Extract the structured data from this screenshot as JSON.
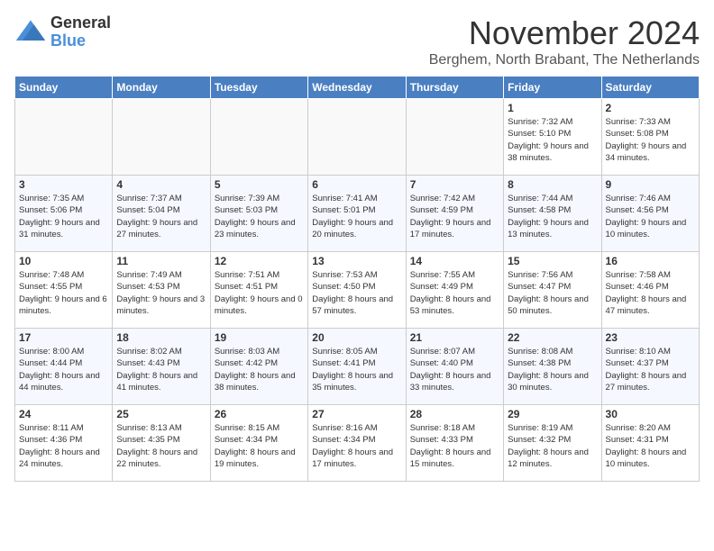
{
  "header": {
    "logo_general": "General",
    "logo_blue": "Blue",
    "title": "November 2024",
    "subtitle": "Berghem, North Brabant, The Netherlands"
  },
  "weekdays": [
    "Sunday",
    "Monday",
    "Tuesday",
    "Wednesday",
    "Thursday",
    "Friday",
    "Saturday"
  ],
  "weeks": [
    [
      {
        "day": "",
        "info": ""
      },
      {
        "day": "",
        "info": ""
      },
      {
        "day": "",
        "info": ""
      },
      {
        "day": "",
        "info": ""
      },
      {
        "day": "",
        "info": ""
      },
      {
        "day": "1",
        "info": "Sunrise: 7:32 AM\nSunset: 5:10 PM\nDaylight: 9 hours and 38 minutes."
      },
      {
        "day": "2",
        "info": "Sunrise: 7:33 AM\nSunset: 5:08 PM\nDaylight: 9 hours and 34 minutes."
      }
    ],
    [
      {
        "day": "3",
        "info": "Sunrise: 7:35 AM\nSunset: 5:06 PM\nDaylight: 9 hours and 31 minutes."
      },
      {
        "day": "4",
        "info": "Sunrise: 7:37 AM\nSunset: 5:04 PM\nDaylight: 9 hours and 27 minutes."
      },
      {
        "day": "5",
        "info": "Sunrise: 7:39 AM\nSunset: 5:03 PM\nDaylight: 9 hours and 23 minutes."
      },
      {
        "day": "6",
        "info": "Sunrise: 7:41 AM\nSunset: 5:01 PM\nDaylight: 9 hours and 20 minutes."
      },
      {
        "day": "7",
        "info": "Sunrise: 7:42 AM\nSunset: 4:59 PM\nDaylight: 9 hours and 17 minutes."
      },
      {
        "day": "8",
        "info": "Sunrise: 7:44 AM\nSunset: 4:58 PM\nDaylight: 9 hours and 13 minutes."
      },
      {
        "day": "9",
        "info": "Sunrise: 7:46 AM\nSunset: 4:56 PM\nDaylight: 9 hours and 10 minutes."
      }
    ],
    [
      {
        "day": "10",
        "info": "Sunrise: 7:48 AM\nSunset: 4:55 PM\nDaylight: 9 hours and 6 minutes."
      },
      {
        "day": "11",
        "info": "Sunrise: 7:49 AM\nSunset: 4:53 PM\nDaylight: 9 hours and 3 minutes."
      },
      {
        "day": "12",
        "info": "Sunrise: 7:51 AM\nSunset: 4:51 PM\nDaylight: 9 hours and 0 minutes."
      },
      {
        "day": "13",
        "info": "Sunrise: 7:53 AM\nSunset: 4:50 PM\nDaylight: 8 hours and 57 minutes."
      },
      {
        "day": "14",
        "info": "Sunrise: 7:55 AM\nSunset: 4:49 PM\nDaylight: 8 hours and 53 minutes."
      },
      {
        "day": "15",
        "info": "Sunrise: 7:56 AM\nSunset: 4:47 PM\nDaylight: 8 hours and 50 minutes."
      },
      {
        "day": "16",
        "info": "Sunrise: 7:58 AM\nSunset: 4:46 PM\nDaylight: 8 hours and 47 minutes."
      }
    ],
    [
      {
        "day": "17",
        "info": "Sunrise: 8:00 AM\nSunset: 4:44 PM\nDaylight: 8 hours and 44 minutes."
      },
      {
        "day": "18",
        "info": "Sunrise: 8:02 AM\nSunset: 4:43 PM\nDaylight: 8 hours and 41 minutes."
      },
      {
        "day": "19",
        "info": "Sunrise: 8:03 AM\nSunset: 4:42 PM\nDaylight: 8 hours and 38 minutes."
      },
      {
        "day": "20",
        "info": "Sunrise: 8:05 AM\nSunset: 4:41 PM\nDaylight: 8 hours and 35 minutes."
      },
      {
        "day": "21",
        "info": "Sunrise: 8:07 AM\nSunset: 4:40 PM\nDaylight: 8 hours and 33 minutes."
      },
      {
        "day": "22",
        "info": "Sunrise: 8:08 AM\nSunset: 4:38 PM\nDaylight: 8 hours and 30 minutes."
      },
      {
        "day": "23",
        "info": "Sunrise: 8:10 AM\nSunset: 4:37 PM\nDaylight: 8 hours and 27 minutes."
      }
    ],
    [
      {
        "day": "24",
        "info": "Sunrise: 8:11 AM\nSunset: 4:36 PM\nDaylight: 8 hours and 24 minutes."
      },
      {
        "day": "25",
        "info": "Sunrise: 8:13 AM\nSunset: 4:35 PM\nDaylight: 8 hours and 22 minutes."
      },
      {
        "day": "26",
        "info": "Sunrise: 8:15 AM\nSunset: 4:34 PM\nDaylight: 8 hours and 19 minutes."
      },
      {
        "day": "27",
        "info": "Sunrise: 8:16 AM\nSunset: 4:34 PM\nDaylight: 8 hours and 17 minutes."
      },
      {
        "day": "28",
        "info": "Sunrise: 8:18 AM\nSunset: 4:33 PM\nDaylight: 8 hours and 15 minutes."
      },
      {
        "day": "29",
        "info": "Sunrise: 8:19 AM\nSunset: 4:32 PM\nDaylight: 8 hours and 12 minutes."
      },
      {
        "day": "30",
        "info": "Sunrise: 8:20 AM\nSunset: 4:31 PM\nDaylight: 8 hours and 10 minutes."
      }
    ]
  ]
}
